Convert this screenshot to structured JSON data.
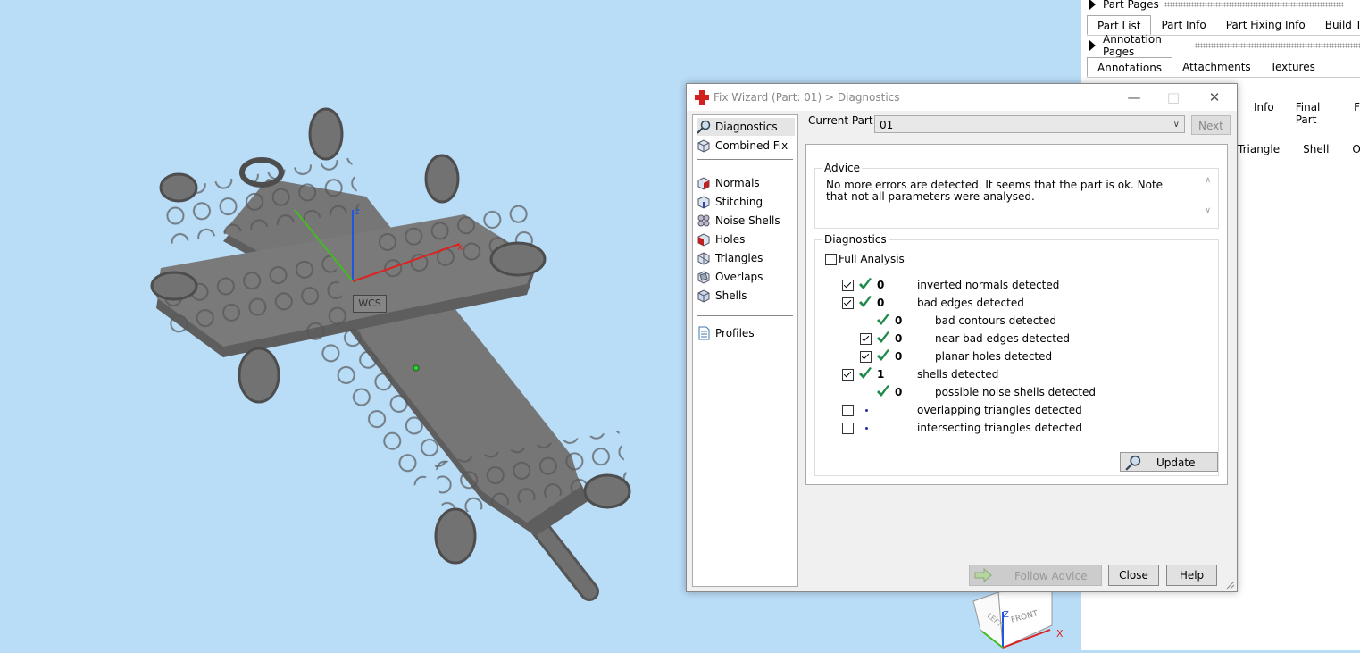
{
  "viewport": {
    "axis_z_label": "z",
    "axis_x_label": "x",
    "wcs_label": "WCS",
    "colors": {
      "background": "#b9dcf7",
      "part": "#7a7a7a"
    }
  },
  "side_panel": {
    "part_pages_header": "Part Pages",
    "part_tabs": [
      "Part List",
      "Part Info",
      "Part Fixing Info",
      "Build Time E"
    ],
    "annotation_pages_header": "Annotation Pages",
    "annotation_tabs": [
      "Annotations",
      "Attachments",
      "Textures"
    ],
    "row2_tabs": [
      "Info",
      "Final Part",
      "F"
    ],
    "row3_tabs": [
      "Triangle",
      "Shell",
      "Over"
    ]
  },
  "nav_cube": {
    "left_face": "LEFT",
    "front_face": "FRONT",
    "z_label": "Z",
    "x_label": "X"
  },
  "dialog": {
    "title": "Fix Wizard (Part: 01) > Diagnostics",
    "nav": {
      "top_items": [
        {
          "label": "Diagnostics",
          "icon": "magnifier-icon"
        },
        {
          "label": "Combined Fix",
          "icon": "cube-icon"
        }
      ],
      "fix_items": [
        {
          "label": "Normals",
          "icon": "normals-icon"
        },
        {
          "label": "Stitching",
          "icon": "stitching-icon"
        },
        {
          "label": "Noise Shells",
          "icon": "noise-shells-icon"
        },
        {
          "label": "Holes",
          "icon": "holes-icon"
        },
        {
          "label": "Triangles",
          "icon": "triangles-icon"
        },
        {
          "label": "Overlaps",
          "icon": "overlaps-icon"
        },
        {
          "label": "Shells",
          "icon": "shells-icon"
        }
      ],
      "profiles": {
        "label": "Profiles",
        "icon": "document-icon"
      }
    },
    "current_part_label": "Current Part:",
    "current_part_value": "01",
    "next_label": "Next",
    "advice_title": "Advice",
    "advice_text": "No more errors are detected. It seems that the part is ok. Note that not all parameters were analysed.",
    "diagnostics_title": "Diagnostics",
    "full_analysis_label": "Full Analysis",
    "full_analysis_checked": false,
    "rows": [
      {
        "checkbox": true,
        "checked": true,
        "status": "ok",
        "count": "0",
        "label": "inverted normals detected",
        "indent": 0
      },
      {
        "checkbox": true,
        "checked": true,
        "status": "ok",
        "count": "0",
        "label": "bad edges detected",
        "indent": 0
      },
      {
        "checkbox": false,
        "checked": false,
        "status": "ok",
        "count": "0",
        "label": "bad contours detected",
        "indent": 1
      },
      {
        "checkbox": true,
        "checked": true,
        "status": "ok",
        "count": "0",
        "label": "near bad edges detected",
        "indent": 1
      },
      {
        "checkbox": true,
        "checked": true,
        "status": "ok",
        "count": "0",
        "label": "planar holes detected",
        "indent": 1
      },
      {
        "checkbox": true,
        "checked": true,
        "status": "ok",
        "count": "1",
        "label": "shells detected",
        "indent": 0
      },
      {
        "checkbox": false,
        "checked": false,
        "status": "ok",
        "count": "0",
        "label": "possible noise shells detected",
        "indent": 1
      },
      {
        "checkbox": true,
        "checked": false,
        "status": "none",
        "count": "",
        "label": "overlapping triangles detected",
        "indent": 0
      },
      {
        "checkbox": true,
        "checked": false,
        "status": "none",
        "count": "",
        "label": "intersecting triangles detected",
        "indent": 0
      }
    ],
    "update_label": "Update",
    "follow_advice_label": "Follow Advice",
    "close_label": "Close",
    "help_label": "Help",
    "colors": {
      "ok_tick": "#1f8a4c",
      "dot": "#2a2ab0"
    }
  }
}
